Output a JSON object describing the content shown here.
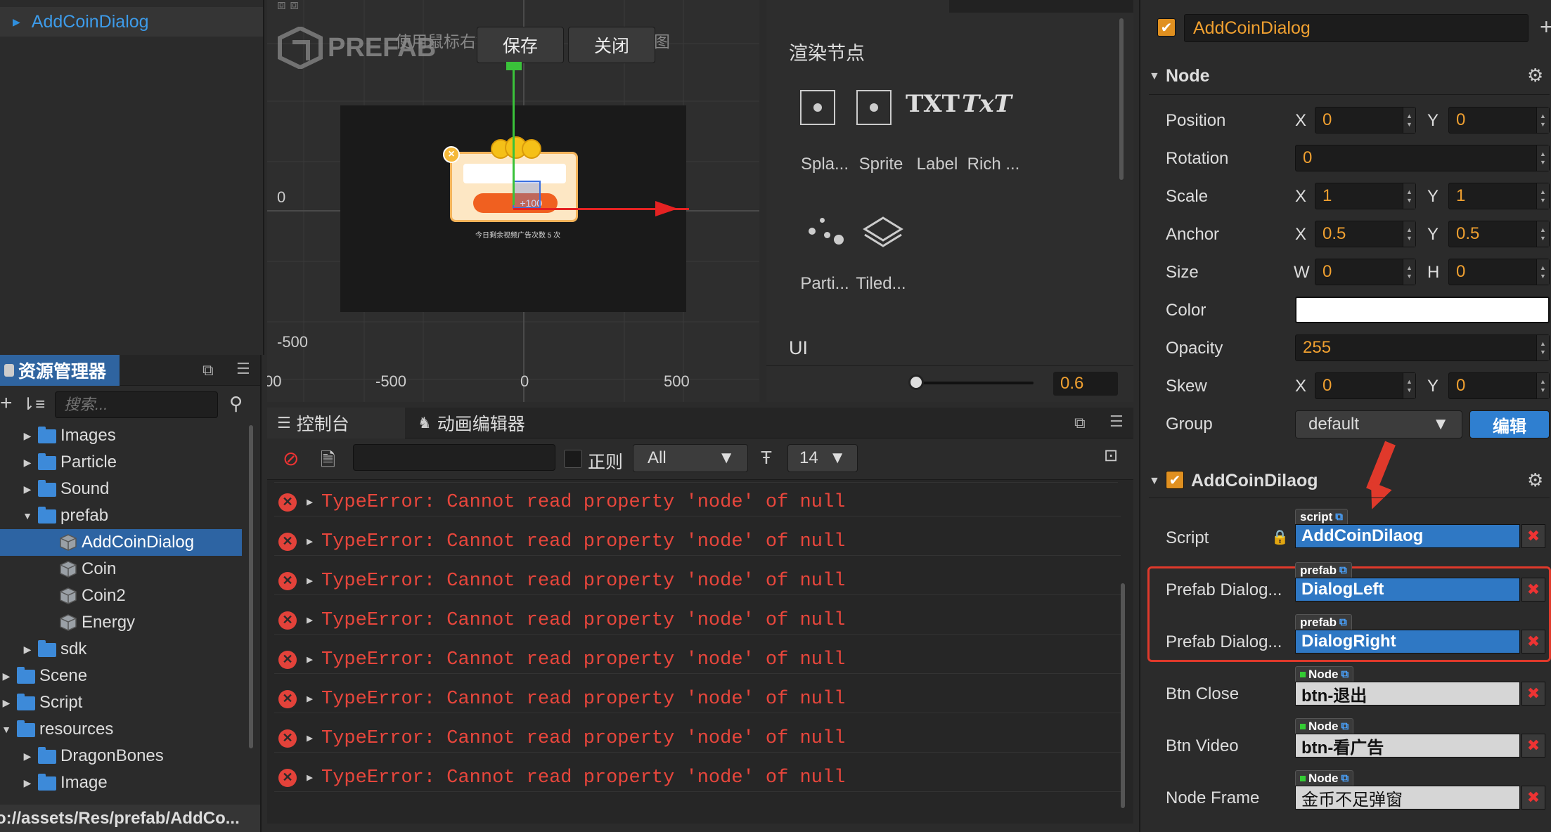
{
  "hierarchy": {
    "root_node": "AddCoinDialog"
  },
  "assets": {
    "tab_label": "资源管理器",
    "search_placeholder": "搜索...",
    "tree": [
      {
        "label": "Images",
        "type": "folder",
        "indent": 2,
        "expanded": false
      },
      {
        "label": "Particle",
        "type": "folder",
        "indent": 2,
        "expanded": false
      },
      {
        "label": "Sound",
        "type": "folder",
        "indent": 2,
        "expanded": false
      },
      {
        "label": "prefab",
        "type": "folder",
        "indent": 2,
        "expanded": true
      },
      {
        "label": "AddCoinDialog",
        "type": "prefab",
        "indent": 3,
        "selected": true
      },
      {
        "label": "Coin",
        "type": "prefab",
        "indent": 3
      },
      {
        "label": "Coin2",
        "type": "prefab",
        "indent": 3
      },
      {
        "label": "Energy",
        "type": "prefab",
        "indent": 3
      },
      {
        "label": "sdk",
        "type": "folder",
        "indent": 2,
        "expanded": false
      },
      {
        "label": "Scene",
        "type": "folder",
        "indent": 1,
        "expanded": false
      },
      {
        "label": "Script",
        "type": "folder",
        "indent": 1,
        "expanded": false
      },
      {
        "label": "resources",
        "type": "folder",
        "indent": 1,
        "expanded": true
      },
      {
        "label": "DragonBones",
        "type": "folder",
        "indent": 2,
        "expanded": false
      },
      {
        "label": "Image",
        "type": "folder",
        "indent": 2,
        "expanded": false
      }
    ],
    "status_path": "o://assets/Res/prefab/AddCo..."
  },
  "scene": {
    "prefab_watermark": "PREFAB",
    "hint_text": "使用鼠标右键平移视图，滚轮缩放视图",
    "save_label": "保存",
    "close_label": "关闭",
    "axis_y_zero": "0",
    "axis_y_neg": "-500",
    "axis_x_left": "00",
    "axis_x_neg": "-500",
    "axis_x_zero": "0",
    "axis_x_pos": "500",
    "dialog_button_text": "+100",
    "dialog_caption": "今日剩余视频广告次数 5 次"
  },
  "node_library": {
    "section_render": "渲染节点",
    "items": [
      "Spla...",
      "Sprite",
      "Label",
      "Rich ..."
    ],
    "items_row2": [
      "Parti...",
      "Tiled..."
    ],
    "label_icon_txt": "TXT",
    "rich_icon_txt": "TxT",
    "section_ui": "UI",
    "zoom_value": "0.6"
  },
  "console": {
    "tab_console": "控制台",
    "tab_animation": "动画编辑器",
    "filter_value": "",
    "regex_label": "正则",
    "level_value": "All",
    "font_size_value": "14",
    "errors": [
      "TypeError: Cannot read property 'node' of null",
      "TypeError: Cannot read property 'node' of null",
      "TypeError: Cannot read property 'node' of null",
      "TypeError: Cannot read property 'node' of null",
      "TypeError: Cannot read property 'node' of null",
      "TypeError: Cannot read property 'node' of null",
      "TypeError: Cannot read property 'node' of null",
      "TypeError: Cannot read property 'node' of null"
    ]
  },
  "inspector": {
    "node_name": "AddCoinDialog",
    "node_section": "Node",
    "labels": {
      "position": "Position",
      "rotation": "Rotation",
      "scale": "Scale",
      "anchor": "Anchor",
      "size": "Size",
      "color": "Color",
      "opacity": "Opacity",
      "skew": "Skew",
      "group": "Group"
    },
    "axis": {
      "x": "X",
      "y": "Y",
      "w": "W",
      "h": "H"
    },
    "values": {
      "position_x": "0",
      "position_y": "0",
      "rotation": "0",
      "scale_x": "1",
      "scale_y": "1",
      "anchor_x": "0.5",
      "anchor_y": "0.5",
      "size_w": "0",
      "size_h": "0",
      "opacity": "255",
      "skew_x": "0",
      "skew_y": "0",
      "group": "default"
    },
    "color_value": "#ffffff",
    "edit_label": "编辑",
    "component_name": "AddCoinDilaog",
    "script_label": "Script",
    "script_tag": "script",
    "script_value": "AddCoinDilaog",
    "prefab_left_label": "Prefab Dialog...",
    "prefab_left_tag": "prefab",
    "prefab_left_value": "DialogLeft",
    "prefab_right_label": "Prefab Dialog...",
    "prefab_right_tag": "prefab",
    "prefab_right_value": "DialogRight",
    "btn_close_label": "Btn Close",
    "btn_close_tag": "Node",
    "btn_close_value": "btn-退出",
    "btn_video_label": "Btn Video",
    "btn_video_tag": "Node",
    "btn_video_value": "btn-看广告",
    "node_frame_label": "Node Frame",
    "node_frame_tag": "Node",
    "node_frame_value": "金币不足弹窗",
    "highlight_color": "#e0392b"
  }
}
